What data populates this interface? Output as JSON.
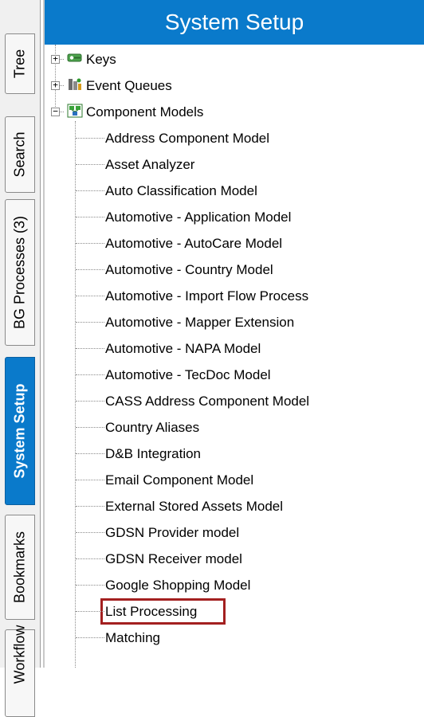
{
  "header": {
    "title": "System Setup"
  },
  "tabs": [
    {
      "label": "Tree",
      "active": false
    },
    {
      "label": "Search",
      "active": false
    },
    {
      "label": "BG Processes (3)",
      "active": false
    },
    {
      "label": "System Setup",
      "active": true
    },
    {
      "label": "Bookmarks",
      "active": false
    },
    {
      "label": "Workflow",
      "active": false
    }
  ],
  "tree": {
    "top_nodes": [
      {
        "label": "Keys",
        "icon": "keys-icon",
        "expanded": false
      },
      {
        "label": "Event Queues",
        "icon": "event-queues-icon",
        "expanded": false
      },
      {
        "label": "Component Models",
        "icon": "component-models-icon",
        "expanded": true
      }
    ],
    "children": [
      "Address Component Model",
      "Asset Analyzer",
      "Auto Classification Model",
      "Automotive - Application Model",
      "Automotive - AutoCare Model",
      "Automotive - Country Model",
      "Automotive - Import Flow Process",
      "Automotive - Mapper Extension",
      "Automotive - NAPA Model",
      "Automotive - TecDoc Model",
      "CASS Address Component Model",
      "Country Aliases",
      "D&B Integration",
      "Email Component Model",
      "External Stored Assets Model",
      "GDSN Provider model",
      "GDSN Receiver model",
      "Google Shopping Model",
      "List Processing",
      "Matching"
    ],
    "highlighted": "List Processing"
  },
  "colors": {
    "accent": "#0a7acb",
    "highlight": "#a32020"
  }
}
